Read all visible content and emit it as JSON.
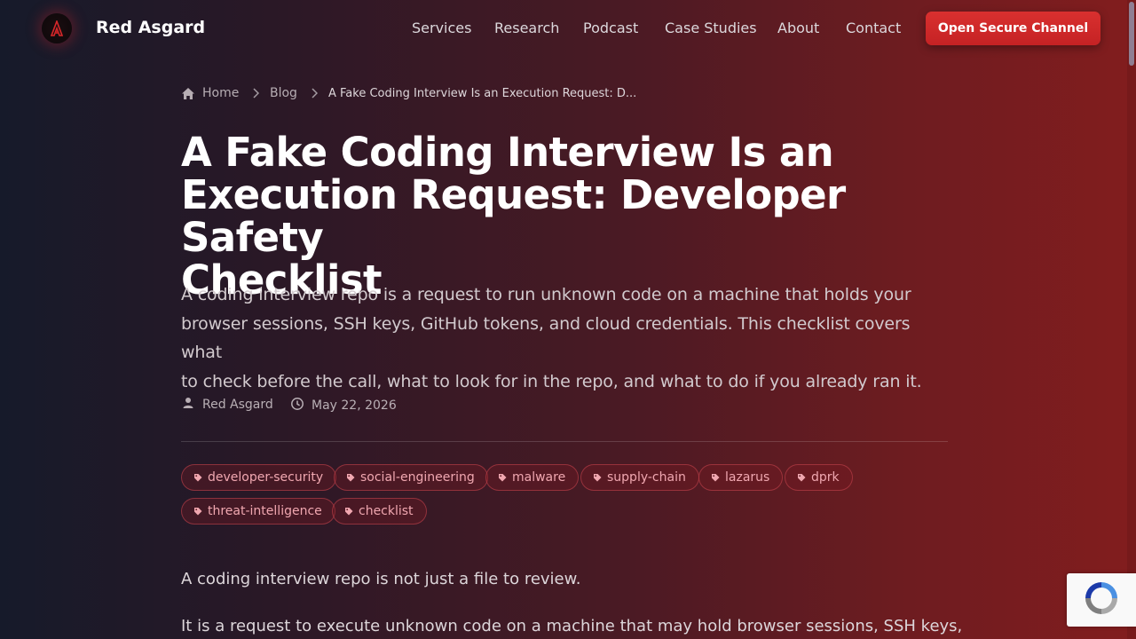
{
  "header": {
    "brand": "Red Asgard",
    "nav": [
      "Services",
      "Research",
      "Podcast",
      "Case Studies",
      "About",
      "Contact"
    ],
    "cta": "Open Secure Channel"
  },
  "breadcrumb": {
    "home": "Home",
    "blog": "Blog",
    "current": "A Fake Coding Interview Is an Execution Request: D..."
  },
  "article": {
    "title_lines": [
      "A Fake Coding Interview Is an",
      "Execution Request: Developer Safety",
      "Checklist"
    ],
    "lead_lines": [
      "A coding interview repo is a request to run unknown code on a machine that holds your",
      "browser sessions, SSH keys, GitHub tokens, and cloud credentials. This checklist covers what",
      "to check before the call, what to look for in the repo, and what to do if you already ran it."
    ],
    "author": "Red Asgard",
    "date": "May 22, 2026",
    "tags": [
      "developer-security",
      "social-engineering",
      "malware",
      "supply-chain",
      "lazarus",
      "dprk",
      "threat-intelligence",
      "checklist"
    ],
    "body": [
      "A coding interview repo is not just a file to review.",
      "It is a request to execute unknown code on a machine that may hold browser sessions, SSH keys,"
    ]
  },
  "icons": {
    "logo": "red-asgard-logo-icon",
    "home": "home-icon",
    "chevron": "chevron-right-icon",
    "author": "person-icon",
    "date": "clock-icon",
    "tag": "tag-icon",
    "recaptcha": "recaptcha-icon"
  },
  "colors": {
    "accent": "#d02a2a",
    "tag_text": "#f0a7b0",
    "title": "#ffffff"
  }
}
